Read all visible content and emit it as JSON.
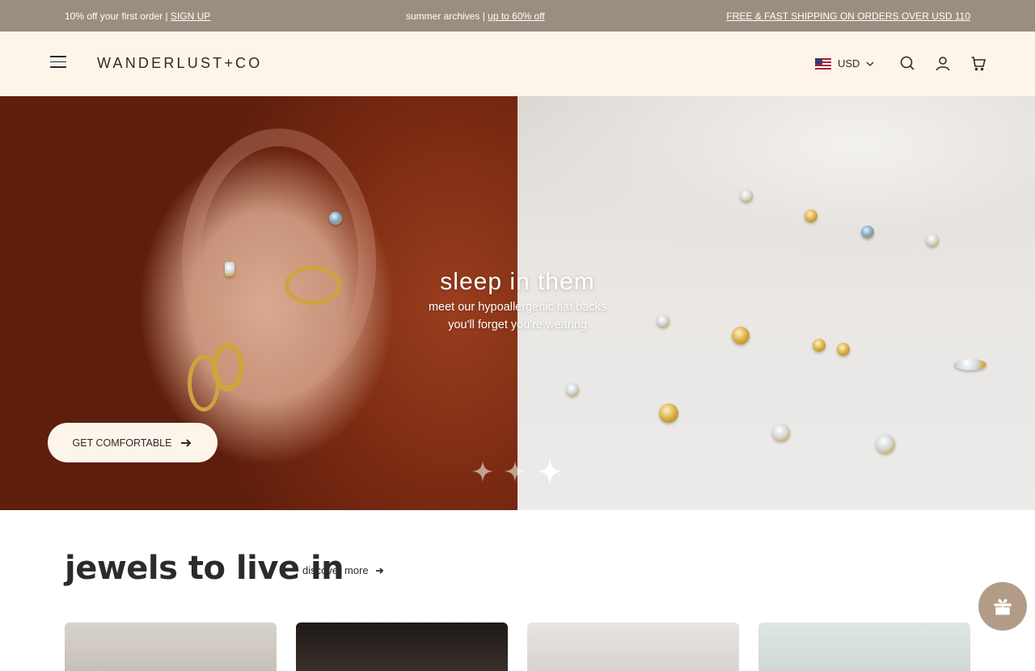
{
  "announcement": {
    "promo_text": "10% off your first order | ",
    "promo_link": "SIGN UP",
    "archive_text": "summer archives | ",
    "archive_link": "up to 60% off",
    "shipping_text": "FREE & FAST SHIPPING ON ORDERS OVER USD 110"
  },
  "header": {
    "logo": "WANDERLUST+CO",
    "currency": "USD",
    "icons": [
      "menu-icon",
      "flag-icon",
      "chevron-down-icon",
      "search-icon",
      "account-icon",
      "cart-icon"
    ]
  },
  "hero": {
    "title": "sleep in them",
    "subtitle_line1": "meet our hypoallergenic flat backs",
    "subtitle_line2": "you'll forget you're wearing",
    "cta_label": "GET COMFORTABLE",
    "slides": 3,
    "active_slide": 3
  },
  "section": {
    "title": "jewels to live in",
    "link_label": "discover more"
  },
  "colors": {
    "announcement_bg": "#9a8e80",
    "header_bg": "#fdf5ea",
    "gift_bg": "#b39c87"
  }
}
